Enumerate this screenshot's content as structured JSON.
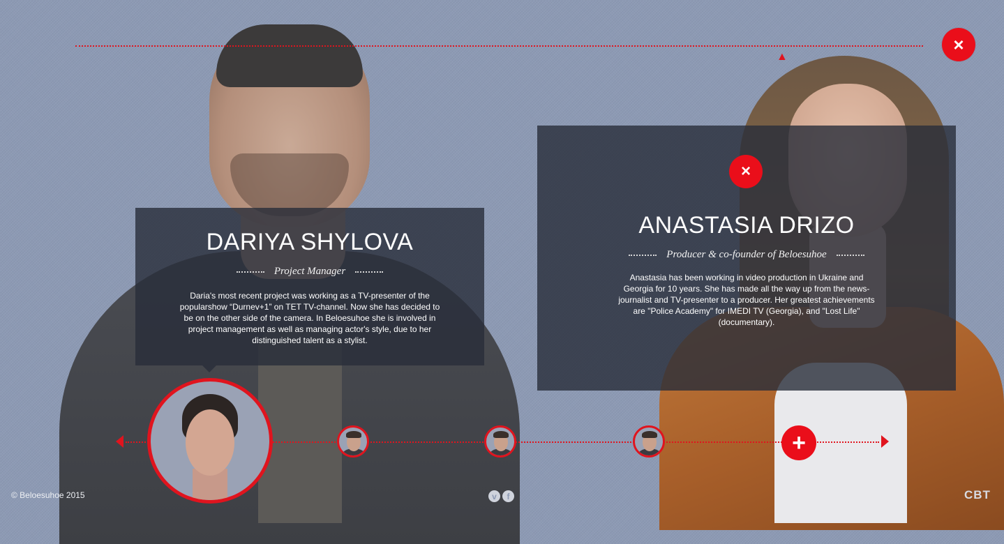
{
  "header": {
    "close_icon": "×"
  },
  "member_left": {
    "name": "DARIYA SHYLOVA",
    "role": "Project Manager",
    "bio": "Daria's most recent project was working as a TV-presenter of the popularshow “Durnev+1” on TET TV-channel. Now she has decided to be on the other side of the camera. In Beloesuhoe she is involved in project management as well as managing actor's style, due to her distinguished talent as a stylist."
  },
  "member_right": {
    "name": "ANASTASIA DRIZO",
    "role": "Producer & co-founder of Beloesuhoe",
    "bio": "Anastasia has been working in video production in Ukraine and Georgia for 10 years. She has made all the way up from the news-journalist and TV-presenter to a producer. Her greatest achievements are \"Police Academy\" for IMEDI TV (Georgia), and \"Lost Life\" (documentary).",
    "close_icon": "×"
  },
  "carousel": {
    "add_icon": "+",
    "thumbs": [
      "team-member-1",
      "team-member-2",
      "team-member-3",
      "team-member-4"
    ]
  },
  "footer": {
    "copyright": "© Beloesuhoe 2015",
    "social": {
      "vimeo": "v",
      "facebook": "f"
    },
    "credit": "CBT"
  },
  "colors": {
    "accent": "#ea0e1a",
    "background": "#8d9ab4",
    "card": "#282d3a"
  }
}
